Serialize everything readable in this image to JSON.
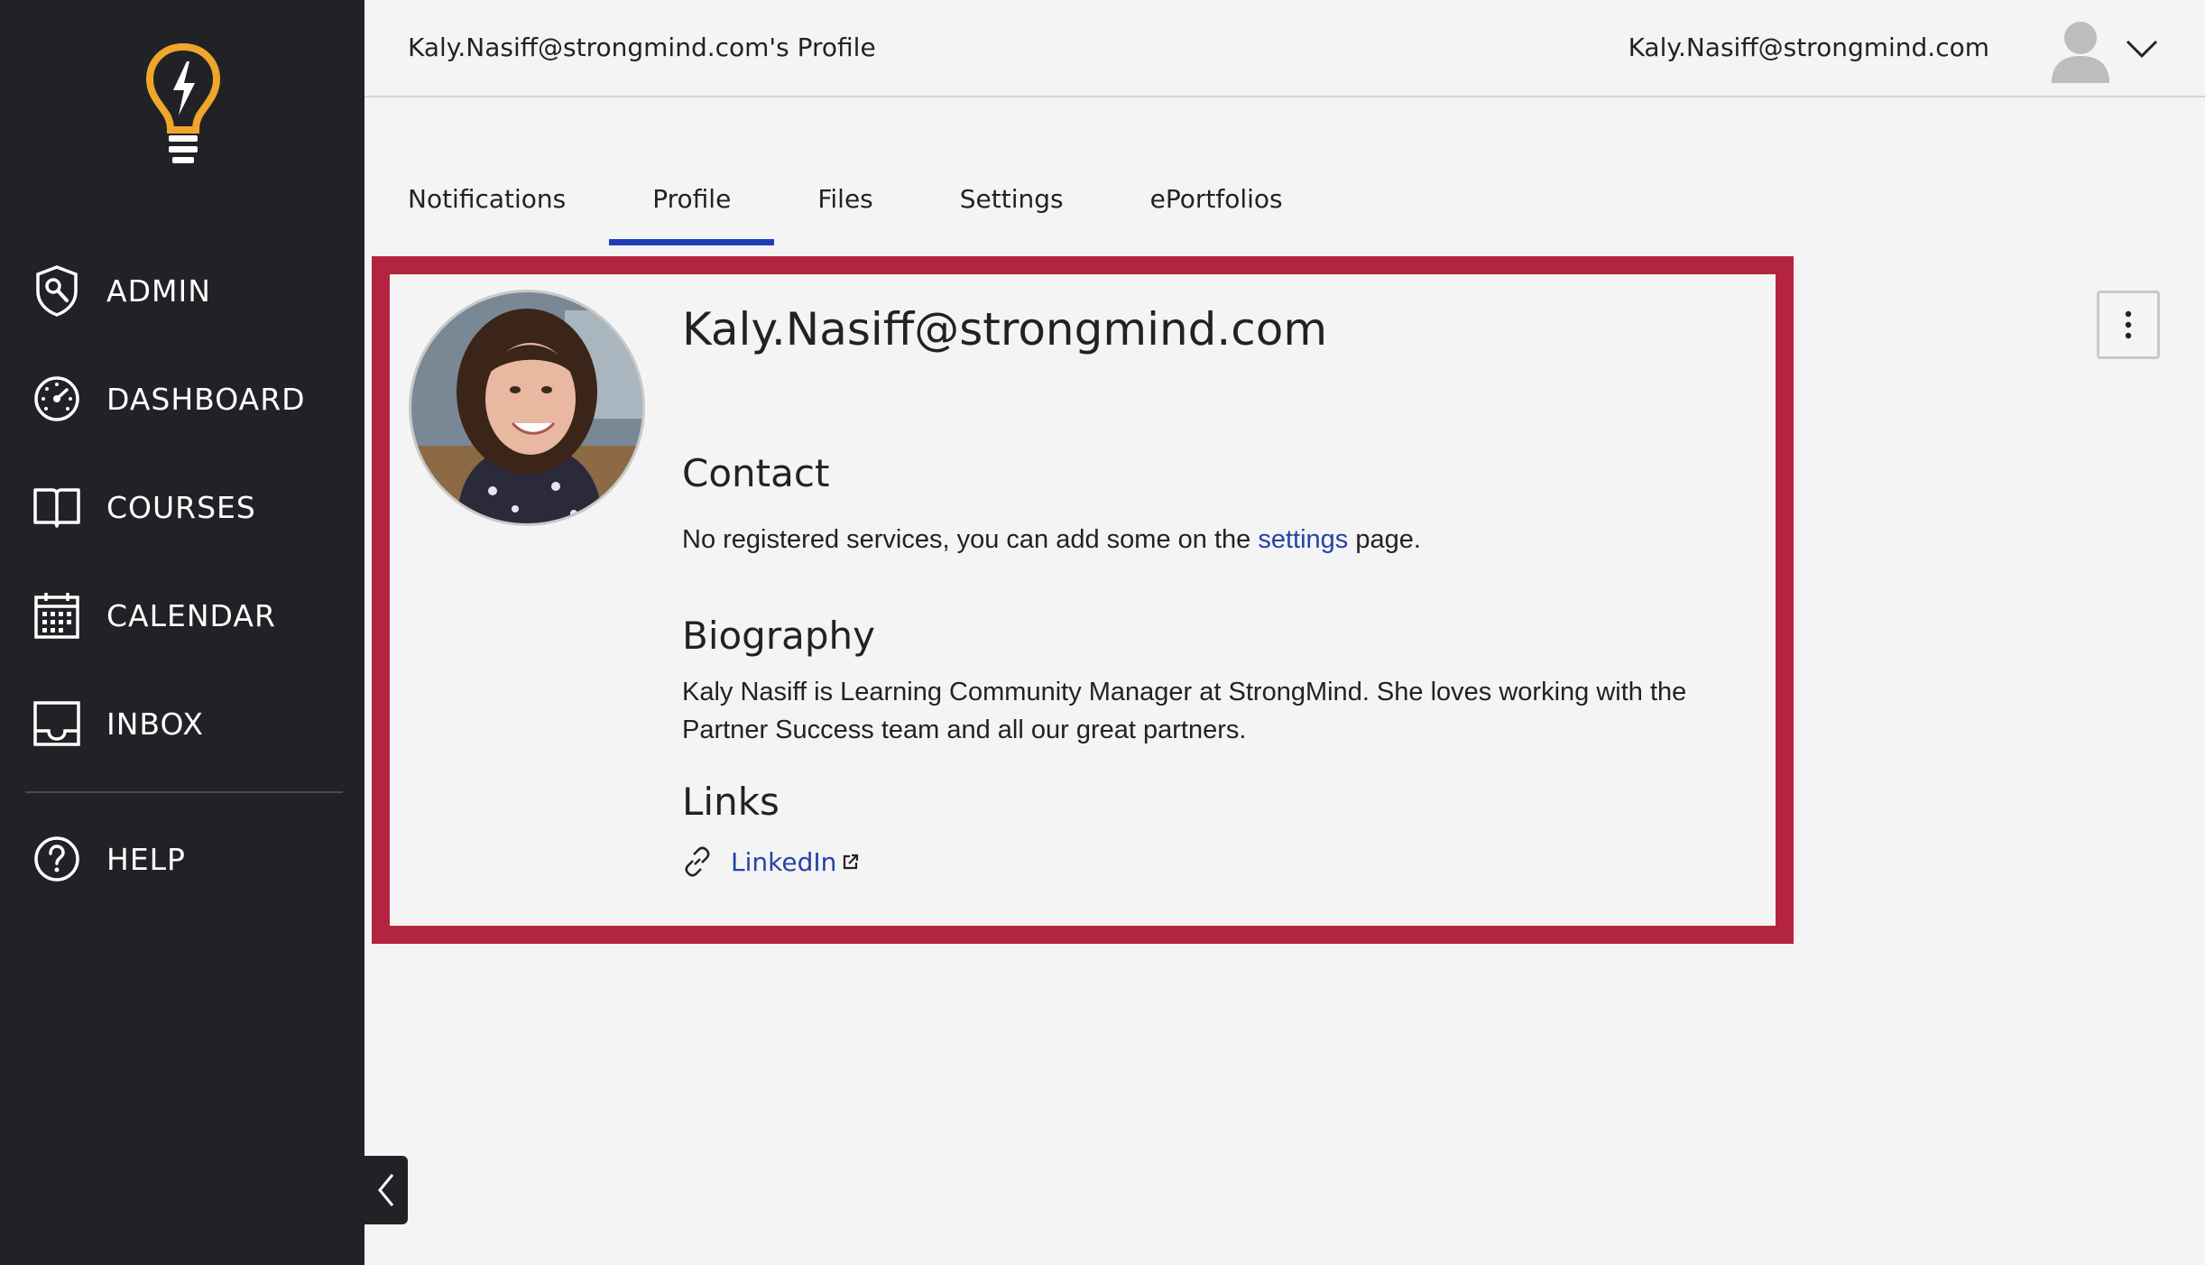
{
  "sidebar": {
    "logo_icon": "lightbulb-bolt-icon",
    "items": [
      {
        "label": "ADMIN",
        "icon": "shield-wrench-icon"
      },
      {
        "label": "DASHBOARD",
        "icon": "speedometer-icon"
      },
      {
        "label": "COURSES",
        "icon": "open-book-icon"
      },
      {
        "label": "CALENDAR",
        "icon": "calendar-icon"
      },
      {
        "label": "INBOX",
        "icon": "inbox-tray-icon"
      },
      {
        "label": "HELP",
        "icon": "question-circle-icon"
      }
    ],
    "collapse_icon": "chevron-left-icon"
  },
  "header": {
    "title": "Kaly.Nasiff@strongmind.com's Profile",
    "user_email": "Kaly.Nasiff@strongmind.com",
    "avatar_icon": "user-silhouette-icon",
    "menu_icon": "chevron-down-icon"
  },
  "tabs": [
    {
      "label": "Notifications",
      "active": false
    },
    {
      "label": "Profile",
      "active": true
    },
    {
      "label": "Files",
      "active": false
    },
    {
      "label": "Settings",
      "active": false
    },
    {
      "label": "ePortfolios",
      "active": false
    }
  ],
  "profile": {
    "name": "Kaly.Nasiff@strongmind.com",
    "contact": {
      "heading": "Contact",
      "text_before": "No registered services, you can add some on the ",
      "link": "settings",
      "text_after": " page."
    },
    "biography": {
      "heading": "Biography",
      "line1": "Kaly Nasiff is Learning Community Manager at StrongMind. She loves working with the",
      "line2": "Partner Success team and all our great partners."
    },
    "links": {
      "heading": "Links",
      "items": [
        {
          "label": "LinkedIn",
          "icon": "chain-link-icon",
          "external_icon": "external-link-icon"
        }
      ]
    },
    "options_icon": "vertical-ellipsis-icon"
  },
  "colors": {
    "sidebar_bg": "#212226",
    "highlight_border": "#b5243f",
    "tab_accent": "#1e3eb8",
    "link": "#2443a8",
    "logo": "#f2a52b"
  }
}
